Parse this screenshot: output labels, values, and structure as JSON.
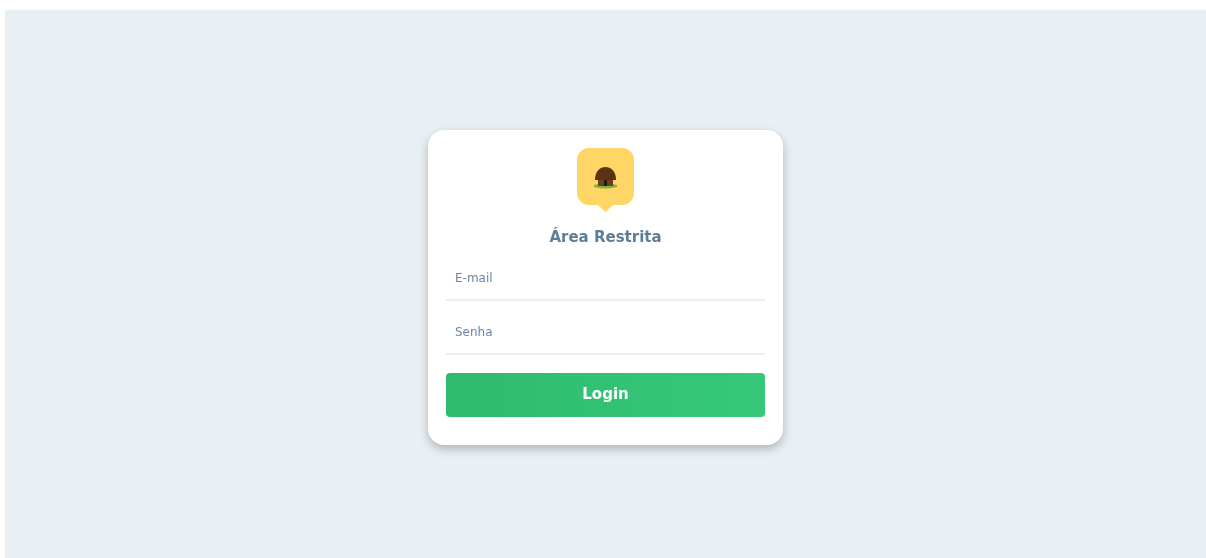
{
  "title": "Área Restrita",
  "fields": [
    {
      "placeholder": "E-mail"
    },
    {
      "placeholder": "Senha"
    }
  ],
  "button": "Login"
}
